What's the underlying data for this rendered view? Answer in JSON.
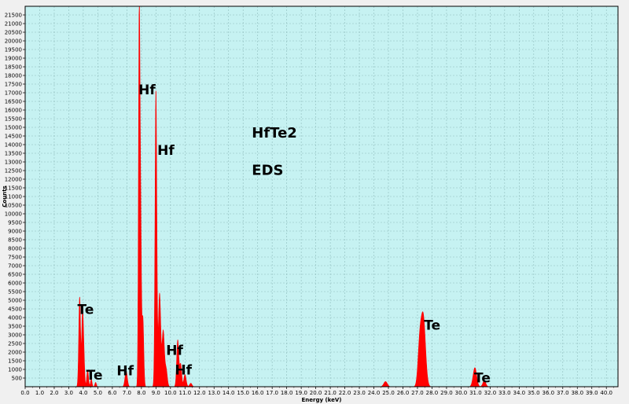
{
  "chart_data": {
    "type": "area",
    "sample_text": [
      "HfTe2",
      "EDS"
    ],
    "xlabel": "Energy (keV)",
    "ylabel": "Counts",
    "xlim": [
      0,
      40.8
    ],
    "ylim": [
      0,
      22000
    ],
    "x_ticks": [
      "0.0",
      "1.0",
      "2.0",
      "3.0",
      "4.0",
      "5.0",
      "6.0",
      "7.0",
      "8.0",
      "9.0",
      "10.0",
      "11.0",
      "12.0",
      "13.0",
      "14.0",
      "15.0",
      "16.0",
      "17.0",
      "18.0",
      "19.0",
      "20.0",
      "21.0",
      "22.0",
      "23.0",
      "24.0",
      "25.0",
      "26.0",
      "27.0",
      "28.0",
      "29.0",
      "30.0",
      "31.0",
      "32.0",
      "33.0",
      "34.0",
      "35.0",
      "36.0",
      "37.0",
      "38.0",
      "39.0",
      "40.0"
    ],
    "y_ticks": [
      "500",
      "1000",
      "1500",
      "2000",
      "2500",
      "3000",
      "3500",
      "4000",
      "4500",
      "5000",
      "5500",
      "6000",
      "6500",
      "7000",
      "7500",
      "8000",
      "8500",
      "9000",
      "9500",
      "10000",
      "10500",
      "11000",
      "11500",
      "12000",
      "12500",
      "13000",
      "13500",
      "14000",
      "14500",
      "15000",
      "15500",
      "16000",
      "16500",
      "17000",
      "17500",
      "18000",
      "18500",
      "19000",
      "19500",
      "20000",
      "20500",
      "21000",
      "21500"
    ],
    "grid": true,
    "fill_color": "#ff0000",
    "plot_background": "#c6f2f2",
    "grid_color": "#8fbcbc",
    "peaks": [
      {
        "x": 3.75,
        "y": 5200,
        "w": 0.06
      },
      {
        "x": 3.95,
        "y": 4300,
        "w": 0.06
      },
      {
        "x": 4.05,
        "y": 1200,
        "w": 0.05
      },
      {
        "x": 4.3,
        "y": 950,
        "w": 0.06
      },
      {
        "x": 4.55,
        "y": 450,
        "w": 0.05
      },
      {
        "x": 4.85,
        "y": 250,
        "w": 0.05
      },
      {
        "x": 6.95,
        "y": 900,
        "w": 0.08
      },
      {
        "x": 7.85,
        "y": 21500,
        "w": 0.05
      },
      {
        "x": 7.95,
        "y": 9000,
        "w": 0.05
      },
      {
        "x": 8.1,
        "y": 4000,
        "w": 0.06
      },
      {
        "x": 9.0,
        "y": 17200,
        "w": 0.06
      },
      {
        "x": 9.25,
        "y": 5400,
        "w": 0.08
      },
      {
        "x": 9.5,
        "y": 3200,
        "w": 0.08
      },
      {
        "x": 9.7,
        "y": 1000,
        "w": 0.08
      },
      {
        "x": 10.5,
        "y": 2700,
        "w": 0.07
      },
      {
        "x": 10.7,
        "y": 1300,
        "w": 0.07
      },
      {
        "x": 11.0,
        "y": 700,
        "w": 0.08
      },
      {
        "x": 11.4,
        "y": 200,
        "w": 0.08
      },
      {
        "x": 24.8,
        "y": 300,
        "w": 0.12
      },
      {
        "x": 27.4,
        "y": 4000,
        "w": 0.15
      },
      {
        "x": 27.15,
        "y": 2200,
        "w": 0.12
      },
      {
        "x": 30.95,
        "y": 1100,
        "w": 0.12
      },
      {
        "x": 31.6,
        "y": 350,
        "w": 0.1
      }
    ],
    "annotations": [
      {
        "text": "Hf",
        "x": 7.8,
        "y": 16900
      },
      {
        "text": "Hf",
        "x": 9.1,
        "y": 13400
      },
      {
        "text": "Te",
        "x": 3.6,
        "y": 4200
      },
      {
        "text": "Te",
        "x": 4.2,
        "y": 400
      },
      {
        "text": "Hf",
        "x": 6.3,
        "y": 650
      },
      {
        "text": "Hf",
        "x": 9.7,
        "y": 1850
      },
      {
        "text": "Hf",
        "x": 10.3,
        "y": 700
      },
      {
        "text": "Te",
        "x": 27.45,
        "y": 3300
      },
      {
        "text": "Te",
        "x": 30.9,
        "y": 250
      }
    ]
  }
}
